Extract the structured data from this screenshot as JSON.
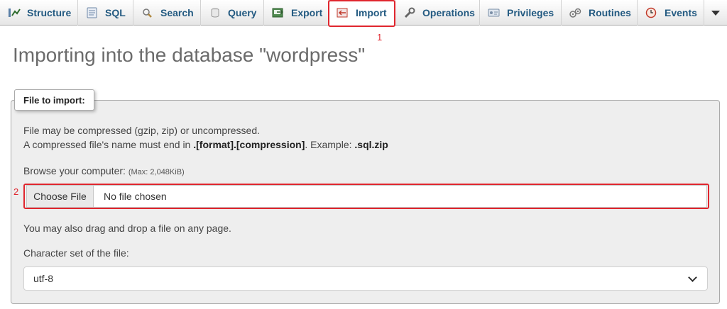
{
  "tabs": [
    {
      "label": "Structure",
      "icon": "structure-icon"
    },
    {
      "label": "SQL",
      "icon": "sql-icon"
    },
    {
      "label": "Search",
      "icon": "search-icon"
    },
    {
      "label": "Query",
      "icon": "query-icon"
    },
    {
      "label": "Export",
      "icon": "export-icon"
    },
    {
      "label": "Import",
      "icon": "import-icon",
      "active": true
    },
    {
      "label": "Operations",
      "icon": "wrench-icon"
    },
    {
      "label": "Privileges",
      "icon": "privileges-icon"
    },
    {
      "label": "Routines",
      "icon": "routines-icon"
    },
    {
      "label": "Events",
      "icon": "clock-icon"
    }
  ],
  "annotations": {
    "one": "1",
    "two": "2",
    "color": "#e0262e"
  },
  "title": "Importing into the database \"wordpress\"",
  "fieldset": {
    "legend": "File to import:",
    "line1": "File may be compressed (gzip, zip) or uncompressed.",
    "line2_prefix": "A compressed file's name must end in ",
    "line2_bold": ".[format].[compression]",
    "line2_mid": ". Example: ",
    "line2_example": ".sql.zip",
    "browse_label": "Browse your computer: ",
    "max_size": "(Max: 2,048KiB)",
    "choose_button": "Choose File",
    "no_file": "No file chosen",
    "drag_drop": "You may also drag and drop a file on any page.",
    "charset_label": "Character set of the file:",
    "charset_value": "utf-8"
  },
  "colors": {
    "link": "#235a81",
    "highlight": "#e0262e"
  }
}
